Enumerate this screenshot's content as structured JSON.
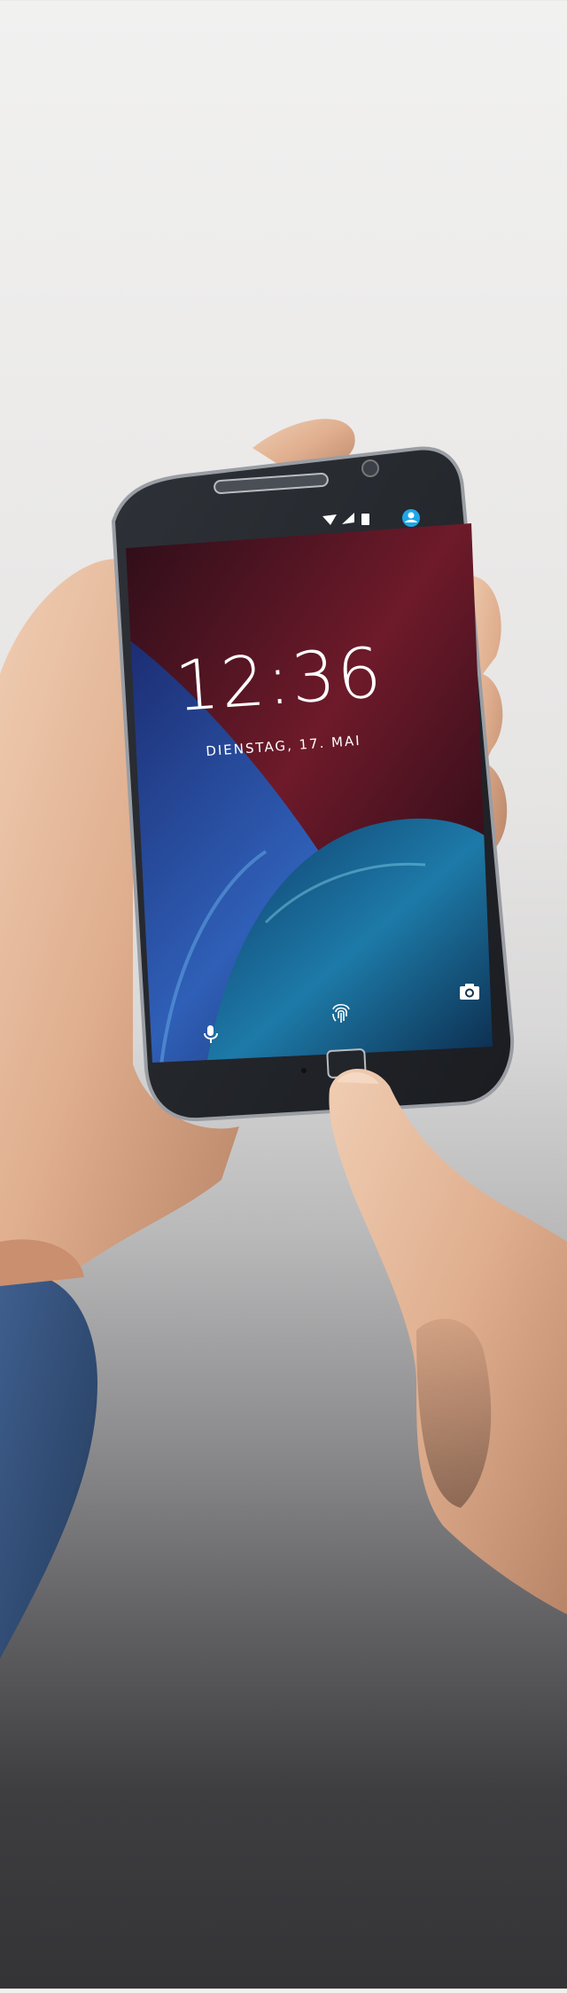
{
  "lockscreen": {
    "time": "12:36",
    "date": "DIENSTAG, 17. MAI",
    "accent_color": "#1fa6e8"
  },
  "icons": {
    "wifi": "wifi-icon",
    "signal": "signal-icon",
    "battery": "battery-icon",
    "account": "account-icon",
    "mic": "microphone-icon",
    "fingerprint": "fingerprint-icon",
    "camera": "camera-icon"
  }
}
